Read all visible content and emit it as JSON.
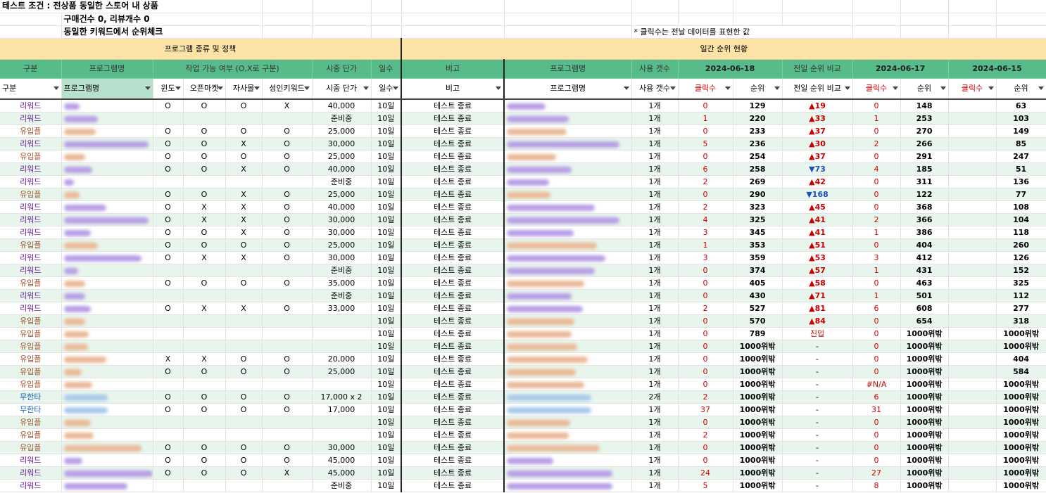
{
  "info": {
    "test_label": "테스트 조건 :",
    "line1": "전상품 동일한 스토어 내 상품",
    "line2": "구매건수 0, 리뷰개수 0",
    "line3": "동일한 키워드에서 순위체크",
    "note": "* 클릭수는 전날 데이터를 표현한 값"
  },
  "sections": {
    "left": "프로그램 종류 및 정책",
    "right": "일간 순위 현황"
  },
  "headers": {
    "category": "구분",
    "program": "프로그램명",
    "work": "작업 가능 여부 (O,X로 구분)",
    "price": "시중 단가",
    "days": "일수",
    "remark": "비고",
    "program2": "프로그램명",
    "count": "사용 갯수",
    "date1": "2024-06-18",
    "compare": "전일 순위 비교",
    "date2": "2024-06-17",
    "date3": "2024-06-15"
  },
  "filters": [
    "구분",
    "프로그램명",
    "윈도",
    "오픈마켓",
    "자사몰",
    "성인키워드",
    "시중 단가",
    "일수",
    "비고",
    "프로그램명",
    "사용 갯수",
    "클릭수",
    "순위",
    "전일 순위 비교",
    "클릭수",
    "순위",
    "클릭수",
    "순위"
  ],
  "colors": {
    "section": "#fde3a7",
    "header": "#57bb8a",
    "alt_row": "#e8f5ec",
    "up": "#cc0000",
    "down": "#1a4fbf"
  },
  "rows": [
    [
      "리워드",
      "O",
      "O",
      "O",
      "X",
      "40,000",
      "10일",
      "테스트 종료",
      "1개",
      "0",
      "129",
      "▲19",
      "0",
      "148",
      "0",
      "63"
    ],
    [
      "리워드",
      "",
      "",
      "",
      "",
      "준비중",
      "10일",
      "테스트 종료",
      "1개",
      "1",
      "220",
      "▲33",
      "1",
      "253",
      "1",
      "103"
    ],
    [
      "유입플",
      "O",
      "O",
      "O",
      "O",
      "25,000",
      "10일",
      "테스트 종료",
      "1개",
      "0",
      "233",
      "▲37",
      "0",
      "270",
      "0",
      "149"
    ],
    [
      "리워드",
      "O",
      "O",
      "X",
      "O",
      "30,000",
      "10일",
      "테스트 종료",
      "1개",
      "5",
      "236",
      "▲30",
      "2",
      "266",
      "2",
      "85"
    ],
    [
      "유입플",
      "O",
      "O",
      "O",
      "O",
      "25,000",
      "10일",
      "테스트 종료",
      "1개",
      "0",
      "254",
      "▲37",
      "0",
      "291",
      "0",
      "247"
    ],
    [
      "리워드",
      "O",
      "O",
      "X",
      "O",
      "40,000",
      "10일",
      "테스트 종료",
      "1개",
      "6",
      "258",
      "▼73",
      "4",
      "185",
      "4",
      "51"
    ],
    [
      "리워드",
      "",
      "",
      "",
      "",
      "준비중",
      "10일",
      "테스트 종료",
      "1개",
      "2",
      "269",
      "▲42",
      "0",
      "311",
      "0",
      "136"
    ],
    [
      "유입플",
      "O",
      "O",
      "X",
      "O",
      "25,000",
      "10일",
      "테스트 종료",
      "1개",
      "0",
      "290",
      "▼168",
      "0",
      "122",
      "0",
      "77"
    ],
    [
      "리워드",
      "O",
      "X",
      "X",
      "O",
      "40,000",
      "10일",
      "테스트 종료",
      "1개",
      "2",
      "323",
      "▲45",
      "0",
      "368",
      "0",
      "108"
    ],
    [
      "리워드",
      "O",
      "X",
      "X",
      "O",
      "30,000",
      "10일",
      "테스트 종료",
      "1개",
      "4",
      "325",
      "▲41",
      "2",
      "366",
      "2",
      "104"
    ],
    [
      "리워드",
      "O",
      "O",
      "X",
      "O",
      "30,000",
      "10일",
      "테스트 종료",
      "1개",
      "3",
      "345",
      "▲41",
      "1",
      "386",
      "1",
      "118"
    ],
    [
      "유입플",
      "O",
      "O",
      "O",
      "O",
      "25,000",
      "10일",
      "테스트 종료",
      "1개",
      "1",
      "353",
      "▲51",
      "0",
      "404",
      "0",
      "260"
    ],
    [
      "리워드",
      "O",
      "X",
      "X",
      "O",
      "30,000",
      "10일",
      "테스트 종료",
      "1개",
      "3",
      "359",
      "▲53",
      "3",
      "412",
      "3",
      "126"
    ],
    [
      "리워드",
      "",
      "",
      "",
      "",
      "준비중",
      "10일",
      "테스트 종료",
      "1개",
      "0",
      "374",
      "▲57",
      "1",
      "431",
      "1",
      "152"
    ],
    [
      "유입플",
      "O",
      "O",
      "O",
      "O",
      "35,000",
      "10일",
      "테스트 종료",
      "1개",
      "0",
      "405",
      "▲58",
      "0",
      "463",
      "0",
      "325"
    ],
    [
      "리워드",
      "",
      "",
      "",
      "",
      "준비중",
      "10일",
      "테스트 종료",
      "1개",
      "0",
      "430",
      "▲71",
      "1",
      "501",
      "1",
      "112"
    ],
    [
      "리워드",
      "O",
      "X",
      "X",
      "O",
      "33,000",
      "10일",
      "테스트 종료",
      "1개",
      "2",
      "527",
      "▲81",
      "6",
      "608",
      "6",
      "277"
    ],
    [
      "유입플",
      "",
      "",
      "",
      "",
      "",
      "10일",
      "테스트 종료",
      "1개",
      "0",
      "570",
      "▲84",
      "0",
      "654",
      "0",
      "318"
    ],
    [
      "유입플",
      "",
      "",
      "",
      "",
      "",
      "10일",
      "테스트 종료",
      "1개",
      "0",
      "789",
      "진입",
      "0",
      "1000위밖",
      "0",
      "1000위밖"
    ],
    [
      "유입플",
      "",
      "",
      "",
      "",
      "",
      "10일",
      "테스트 종료",
      "1개",
      "0",
      "1000위밖",
      "-",
      "0",
      "1000위밖",
      "0",
      "1000위밖"
    ],
    [
      "유입플",
      "X",
      "X",
      "O",
      "O",
      "20,000",
      "10일",
      "테스트 종료",
      "1개",
      "0",
      "1000위밖",
      "-",
      "0",
      "1000위밖",
      "0",
      "404"
    ],
    [
      "유입플",
      "O",
      "O",
      "O",
      "O",
      "25,000",
      "10일",
      "테스트 종료",
      "1개",
      "0",
      "1000위밖",
      "-",
      "0",
      "1000위밖",
      "0",
      "584"
    ],
    [
      "유입플",
      "",
      "",
      "",
      "",
      "",
      "10일",
      "테스트 종료",
      "1개",
      "0",
      "1000위밖",
      "-",
      "#N/A",
      "1000위밖",
      "#N/A",
      "1000위밖"
    ],
    [
      "무한타",
      "O",
      "O",
      "O",
      "O",
      "17,000 x 2",
      "10일",
      "테스트 종료",
      "2개",
      "2",
      "1000위밖",
      "-",
      "6",
      "1000위밖",
      "6",
      "1000위밖"
    ],
    [
      "무한타",
      "O",
      "O",
      "O",
      "O",
      "17,000",
      "10일",
      "테스트 종료",
      "1개",
      "37",
      "1000위밖",
      "-",
      "31",
      "1000위밖",
      "31",
      "1000위밖"
    ],
    [
      "유입플",
      "",
      "",
      "",
      "",
      "",
      "10일",
      "테스트 종료",
      "1개",
      "0",
      "1000위밖",
      "-",
      "0",
      "1000위밖",
      "0",
      "1000위밖"
    ],
    [
      "유입플",
      "",
      "",
      "",
      "",
      "",
      "10일",
      "테스트 종료",
      "1개",
      "2",
      "1000위밖",
      "-",
      "0",
      "1000위밖",
      "0",
      "1000위밖"
    ],
    [
      "유입플",
      "O",
      "O",
      "O",
      "O",
      "30,000",
      "10일",
      "테스트 종료",
      "1개",
      "0",
      "1000위밖",
      "-",
      "0",
      "1000위밖",
      "0",
      "1000위밖"
    ],
    [
      "리워드",
      "O",
      "O",
      "O",
      "O",
      "45,000",
      "10일",
      "테스트 종료",
      "1개",
      "0",
      "1000위밖",
      "-",
      "0",
      "1000위밖",
      "0",
      "1000위밖"
    ],
    [
      "리워드",
      "O",
      "O",
      "O",
      "X",
      "45,000",
      "10일",
      "테스트 종료",
      "1개",
      "24",
      "1000위밖",
      "-",
      "27",
      "1000위밖",
      "27",
      "1000위밖"
    ],
    [
      "리워드",
      "",
      "",
      "",
      "",
      "준비중",
      "10일",
      "테스트 종료",
      "1개",
      "5",
      "1000위밖",
      "-",
      "8",
      "1000위밖",
      "8",
      "1000위밖"
    ]
  ]
}
